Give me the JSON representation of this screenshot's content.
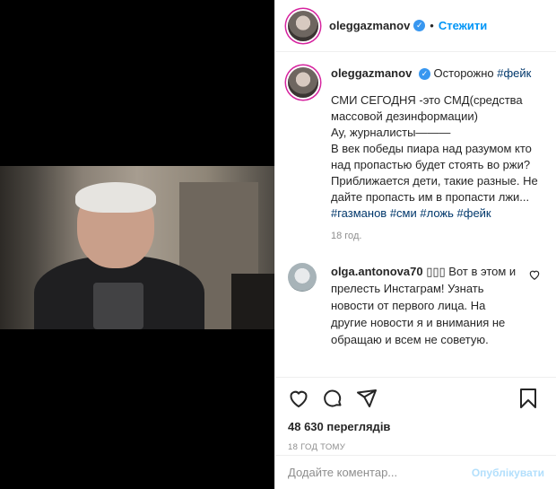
{
  "post": {
    "username": "oleggazmanov",
    "follow_label": "Стежити",
    "dot": "•",
    "caption": {
      "username": "oleggazmanov",
      "lead": "Осторожно",
      "lead_tag": "#фейк",
      "text_lines": "СМИ СЕГОДНЯ -это СМД(средства массовой дезинформации)\nАу, журналисты———\nВ век победы пиара над разумом кто над пропастью будет стоять во ржи? Приближается дети, такие разные. Не дайте пропасть им в пропасти лжи...",
      "tags": [
        " #газманов",
        " #сми",
        " #ложь",
        " #фейк"
      ],
      "time": "18 год."
    },
    "comment": {
      "username": "olga.antonova70",
      "emojis": "▯▯▯",
      "text": "Вот в этом и прелесть Инстаграм! Узнать новости от первого лица. На другие новости я и внимания не обращаю и всем не советую."
    },
    "views": "48 630 переглядів",
    "posted": "18 ГОД ТОМУ",
    "add_comment_placeholder": "Додайте коментар...",
    "publish_label": "Опублікувати"
  },
  "icons": [
    "heart-icon",
    "comment-icon",
    "share-icon",
    "bookmark-icon",
    "verified-icon"
  ],
  "colors": {
    "link": "#0095f6",
    "tag": "#00376b",
    "muted": "#8e8e8e",
    "border": "#efefef",
    "verified": "#3897f0"
  }
}
